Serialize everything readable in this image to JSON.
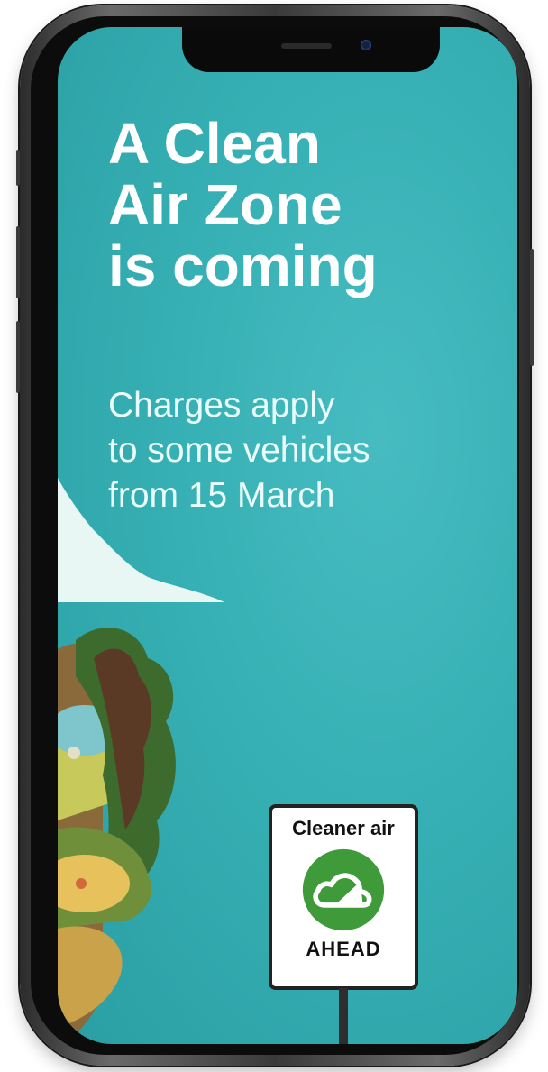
{
  "poster": {
    "headline_lines": [
      "A Clean",
      "Air Zone",
      "is coming"
    ],
    "subtext_lines": [
      "Charges apply",
      "to some vehicles",
      "from 15 March"
    ]
  },
  "sign": {
    "top_text": "Cleaner air",
    "bottom_text": "AHEAD",
    "logo_icon": "cloud-icon",
    "logo_color": "#3f9a3a"
  },
  "colors": {
    "background": "#36b0b4",
    "phone_frame": "#2b2b2b"
  }
}
